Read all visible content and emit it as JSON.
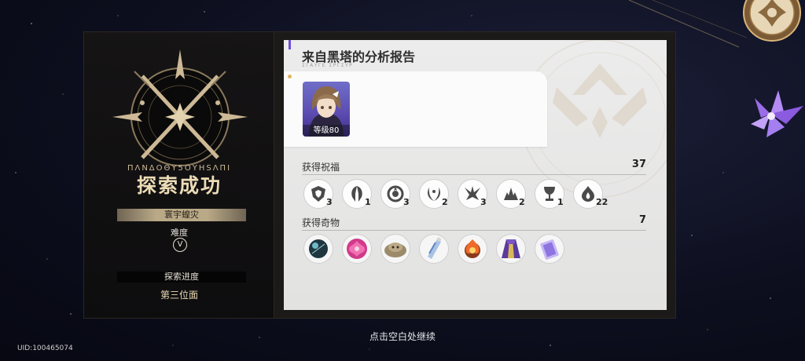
{
  "left_panel": {
    "rune_text": "ΠΛΝΔΟΘΥ5ΟΥΗЅΛΠΙ",
    "result_title": "探索成功",
    "world_name": "寰宇蝗灾",
    "difficulty_label": "难度",
    "difficulty_value": "V",
    "progress_label": "探索进度",
    "progress_value": "第三位面"
  },
  "report": {
    "title": "来自黑塔的分析报告",
    "subtitle": "ΣΓΑΥΓΕ ΣΡΓΣΥΡ",
    "character": {
      "level_label": "等级80"
    }
  },
  "blessings": {
    "title": "获得祝福",
    "count": "37",
    "items": [
      {
        "icon": "preservation-shield-icon",
        "count": "3"
      },
      {
        "icon": "remembrance-icon",
        "count": "1"
      },
      {
        "icon": "abundance-icon",
        "count": "3"
      },
      {
        "icon": "laurel-icon",
        "count": "2"
      },
      {
        "icon": "nihility-icon",
        "count": "3"
      },
      {
        "icon": "elation-icon",
        "count": "2"
      },
      {
        "icon": "chalice-icon",
        "count": "1"
      },
      {
        "icon": "propagation-flame-icon",
        "count": "22"
      }
    ]
  },
  "curios": {
    "title": "获得奇物",
    "count": "7",
    "items": [
      {
        "icon": "dark-orb-curio-icon"
      },
      {
        "icon": "pink-flower-curio-icon"
      },
      {
        "icon": "rock-creature-curio-icon"
      },
      {
        "icon": "tube-curio-icon"
      },
      {
        "icon": "fire-orb-curio-icon"
      },
      {
        "icon": "purple-robe-curio-icon"
      },
      {
        "icon": "ticket-curio-icon"
      }
    ]
  },
  "footer": {
    "continue_hint": "点击空白处继续",
    "uid": "UID:100465074"
  },
  "colors": {
    "gold": "#ecdcb6",
    "accent_purple": "#6f4fd8",
    "report_bg": "#e9e9e9"
  }
}
